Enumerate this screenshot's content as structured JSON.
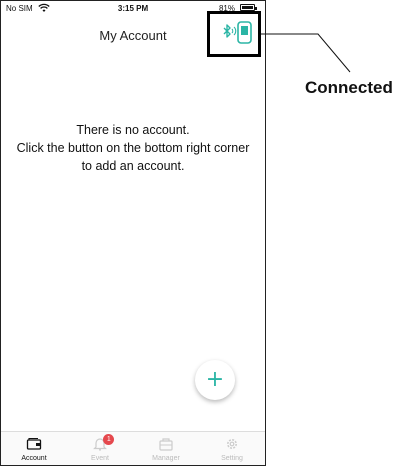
{
  "status_bar": {
    "carrier": "No SIM",
    "time": "3:15 PM",
    "battery": "81%",
    "wifi_icon": "wifi-icon",
    "battery_icon": "battery-icon"
  },
  "header": {
    "title": "My Account",
    "device_status_icon": "bluetooth-device-connected-icon"
  },
  "empty_state": {
    "line1": "There is no account.",
    "line2": "Click the button on the bottom right corner",
    "line3": "to add an account."
  },
  "add_button": {
    "label": "+",
    "icon": "plus-icon"
  },
  "tabs": [
    {
      "label": "Account",
      "icon": "wallet-icon",
      "active": true
    },
    {
      "label": "Event",
      "icon": "bell-icon",
      "badge": "1"
    },
    {
      "label": "Manager",
      "icon": "manager-icon"
    },
    {
      "label": "Setting",
      "icon": "gear-icon"
    }
  ],
  "annotation": {
    "label": "Connected"
  },
  "colors": {
    "accent": "#2bb5a5",
    "badge": "#e5484d",
    "inactive_tab": "#bbbbbb"
  }
}
